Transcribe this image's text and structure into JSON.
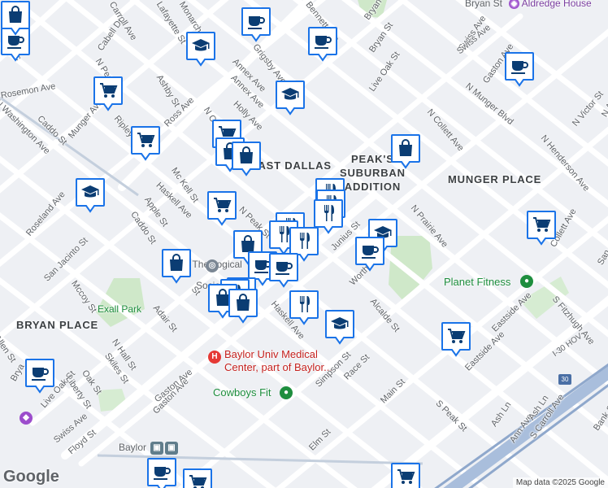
{
  "map": {
    "attribution": "Map data ©2025 Google",
    "logo": "Google",
    "neighborhoods": {
      "east_dallas": "EAST DALLAS",
      "peaks_line1": "PEAK'S",
      "peaks_line2": "SUBURBAN",
      "peaks_line3": "ADDITION",
      "munger_place": "MUNGER PLACE",
      "bryan_place": "BRYAN PLACE"
    },
    "places": {
      "aldredge": "Aldredge House",
      "bryan_st_top": "Bryan St",
      "dallas_society_line1": "Dallas Theological",
      "dallas_society_line2": "Society",
      "exall_park": "Exall Park",
      "planet_fitness": "Planet Fitness",
      "baylor_med_line1": "Baylor Univ Medical",
      "baylor_med_line2": "Center, part of Baylor...",
      "cowboys_fit": "Cowboys Fit",
      "baylor_station": "Baylor",
      "highway": "I-30 HOV",
      "highway_shield": "30"
    },
    "streets": [
      {
        "name": "Carroll Ave"
      },
      {
        "name": "Lafayette St"
      },
      {
        "name": "Monarch"
      },
      {
        "name": "Bennett Ave"
      },
      {
        "name": "Bryan St"
      },
      {
        "name": "Swiss Ave"
      },
      {
        "name": "Gaston Ave"
      },
      {
        "name": "Cabell Dr"
      },
      {
        "name": "N Peak St"
      },
      {
        "name": "Grigsby Ave"
      },
      {
        "name": "Live Oak St"
      },
      {
        "name": "N Munger Blvd"
      },
      {
        "name": "Ashby St"
      },
      {
        "name": "Annex Ave"
      },
      {
        "name": "Holly Ave"
      },
      {
        "name": "Ross Ave"
      },
      {
        "name": "N Carroll Ave"
      },
      {
        "name": "Caddo St"
      },
      {
        "name": "N Washington Ave"
      },
      {
        "name": "Munger Ave"
      },
      {
        "name": "Ripley St"
      },
      {
        "name": "N Collett Ave"
      },
      {
        "name": "N Victor St"
      },
      {
        "name": "N Henderson Ave"
      },
      {
        "name": "Mc Kell St"
      },
      {
        "name": "Haskell Ave"
      },
      {
        "name": "N Peak St"
      },
      {
        "name": "Roseland Ave"
      },
      {
        "name": "Apple St"
      },
      {
        "name": "Caddo St"
      },
      {
        "name": "N Prairie Ave"
      },
      {
        "name": "Collett Ave"
      },
      {
        "name": "San Jacinto St"
      },
      {
        "name": "Mccoy St"
      },
      {
        "name": "Junius St"
      },
      {
        "name": "Worth St"
      },
      {
        "name": "Alcalde St"
      },
      {
        "name": "S Fitzhugh Ave"
      },
      {
        "name": "Eastside Ave"
      },
      {
        "name": "Adair St"
      },
      {
        "name": "Allen St"
      },
      {
        "name": "N Hall St"
      },
      {
        "name": "Skiles St"
      },
      {
        "name": "Live Oak St"
      },
      {
        "name": "Oak St"
      },
      {
        "name": "Liberty St"
      },
      {
        "name": "Gaston Ave"
      },
      {
        "name": "Simpson St"
      },
      {
        "name": "Race St"
      },
      {
        "name": "Main St"
      },
      {
        "name": "S Peak St"
      },
      {
        "name": "Ash Ln"
      },
      {
        "name": "Ann Ave"
      },
      {
        "name": "S Carroll Ave"
      },
      {
        "name": "Bank St"
      },
      {
        "name": "Swiss Ave"
      },
      {
        "name": "Floyd St"
      },
      {
        "name": "Elm St"
      },
      {
        "name": "Haskell Ave"
      },
      {
        "name": "Eastside Ave"
      },
      {
        "name": "Ash Ln"
      },
      {
        "name": "Gaston Ave"
      },
      {
        "name": "Swiss Ave"
      },
      {
        "name": "Annex Ave"
      },
      {
        "name": "Bryan St"
      },
      {
        "name": "N Aug"
      },
      {
        "name": "San"
      },
      {
        "name": "Mc"
      },
      {
        "name": "Brya"
      },
      {
        "name": "Rosemon Ave"
      },
      {
        "name": "St"
      }
    ],
    "markers": [
      {
        "kind": "cafe"
      },
      {
        "kind": "school"
      },
      {
        "kind": "cafe"
      },
      {
        "kind": "cafe"
      },
      {
        "kind": "cafe"
      },
      {
        "kind": "cart"
      },
      {
        "kind": "school"
      },
      {
        "kind": "cart"
      },
      {
        "kind": "cart"
      },
      {
        "kind": "bag"
      },
      {
        "kind": "bag"
      },
      {
        "kind": "bag"
      },
      {
        "kind": "bag"
      },
      {
        "kind": "school"
      },
      {
        "kind": "cart"
      },
      {
        "kind": "fork"
      },
      {
        "kind": "fork"
      },
      {
        "kind": "fork"
      },
      {
        "kind": "fork"
      },
      {
        "kind": "fork"
      },
      {
        "kind": "fork"
      },
      {
        "kind": "school"
      },
      {
        "kind": "cart"
      },
      {
        "kind": "bag"
      },
      {
        "kind": "bag"
      },
      {
        "kind": "cafe"
      },
      {
        "kind": "cafe"
      },
      {
        "kind": "bag"
      },
      {
        "kind": "fork"
      },
      {
        "kind": "bag"
      },
      {
        "kind": "bag"
      },
      {
        "kind": "fork"
      },
      {
        "kind": "school"
      },
      {
        "kind": "cart"
      },
      {
        "kind": "cafe"
      },
      {
        "kind": "cafe"
      },
      {
        "kind": "cart"
      },
      {
        "kind": "cart"
      },
      {
        "kind": "cafe"
      }
    ],
    "colors": {
      "background": "#eef0f4",
      "road": "#ffffff",
      "park": "#c8e6c9",
      "marker_fill": "#ffffff",
      "marker_border": "#1a73e8",
      "marker_glyph": "#0b3d73",
      "highway": "#9fb6d6",
      "rail": "#b7c5d8"
    }
  }
}
